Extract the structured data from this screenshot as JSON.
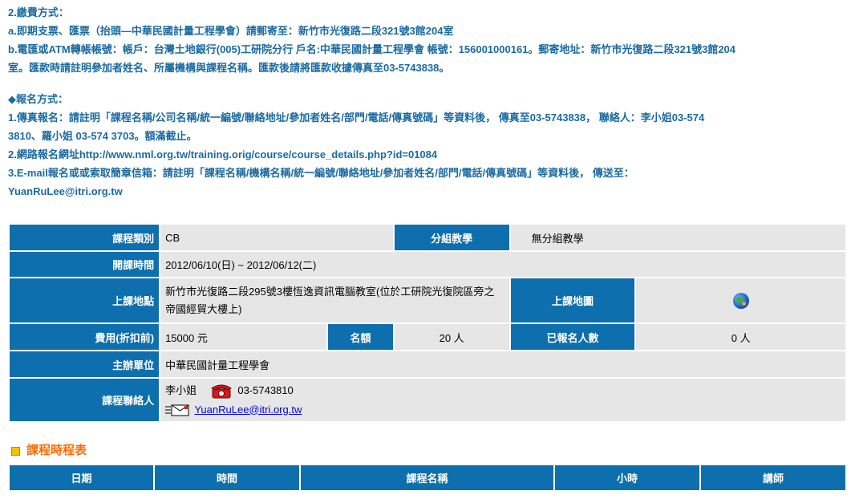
{
  "payment": {
    "heading": "2.繳費方式：",
    "line_a": "a.即期支票、匯票（抬頭—中華民國計量工程學會）請郵寄至：新竹市光復路二段321號3館204室",
    "line_b1": "b.電匯或ATM轉帳帳號：帳戶：台灣土地銀行(005)工研院分行 戶名:中華民國計量工程學會 帳號：156001000161。郵寄地址：新竹市光復路二段321號3館204",
    "line_b2": "室。匯款時請註明參加者姓名、所屬機構與課程名稱。匯款後請將匯款收據傳真至03-5743838。"
  },
  "registration": {
    "heading": "◆報名方式：",
    "line1a": "1.傳真報名：請註明「課程名稱/公司名稱/統一編號/聯絡地址/參加者姓名/部門/電話/傳真號碼」等資料後， 傳真至03-5743838， 聯絡人：李小姐03-574",
    "line1b": "3810、羅小姐 03-574 3703。額滿截止。",
    "line2": "2.網路報名網址http://www.nml.org.tw/training.orig/course/course_details.php?id=01084",
    "line3a": "3.E-mail報名或或索取簡章信箱：請註明「課程名稱/機構名稱/統一編號/聯絡地址/參加者姓名/部門/電話/傳真號碼」等資料後， 傳送至：",
    "line3b": "YuanRuLee@itri.org.tw"
  },
  "course": {
    "category_label": "課程類別",
    "category_value": "CB",
    "group_label": "分組教學",
    "group_value": "無分組教學",
    "date_label": "開課時間",
    "date_value": "2012/06/10(日) ~ 2012/06/12(二)",
    "location_label": "上課地點",
    "location_value": "新竹市光復路二段295號3樓恆逸資訊電腦教室(位於工研院光復院區旁之帝國經貿大樓上)",
    "map_label": "上課地圖",
    "map_icon": "globe-icon",
    "fee_label": "費用(折扣前)",
    "fee_value": "15000 元",
    "quota_label": "名額",
    "quota_value": "20 人",
    "registered_label": "已報名人數",
    "registered_value": "0 人",
    "organizer_label": "主辦單位",
    "organizer_value": "中華民國計量工程學會",
    "contact_label": "課程聯絡人",
    "contact_name": "李小姐",
    "contact_phone": "03-5743810",
    "contact_email": "YuanRuLee@itri.org.tw",
    "phone_icon": "phone-icon",
    "mail_icon": "mail-icon"
  },
  "schedule": {
    "title": "課程時程表",
    "columns": [
      "日期",
      "時間",
      "課程名稱",
      "小時",
      "講師"
    ]
  },
  "colors": {
    "header_blue": "#0d6fad",
    "text_blue": "#1a6aa2",
    "cell_gray": "#e6e6e6",
    "section_orange": "#ff6a00"
  }
}
